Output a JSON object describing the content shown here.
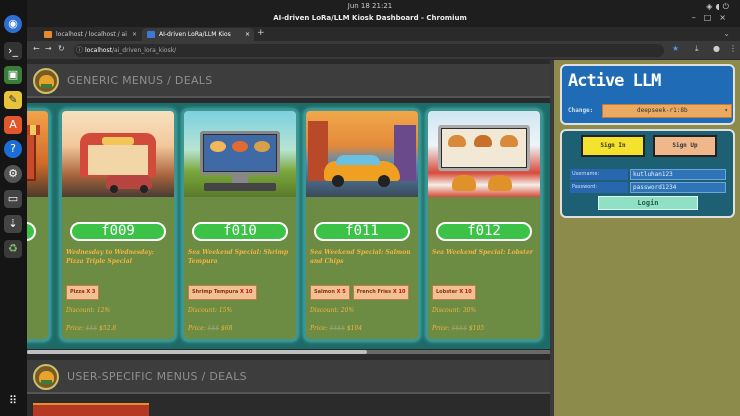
{
  "system": {
    "datetime": "Jun 18  21:21",
    "window_title": "AI-driven LoRa/LLM Kiosk Dashboard - Chromium"
  },
  "browser": {
    "tabs": [
      {
        "label": "localhost / localhost / ai",
        "active": false
      },
      {
        "label": "AI-driven LoRa/LLM Kios",
        "active": true
      }
    ],
    "url_host": "localhost",
    "url_path": "/ai_driven_lora_kiosk/"
  },
  "sections": {
    "generic_title": "GENERIC MENUS / DEALS",
    "user_title": "USER-SPECIFIC MENUS / DEALS"
  },
  "cards": [
    {
      "id": "f009",
      "title": "Wednesday to Wednesday: Pizza Triple Special",
      "items": [
        {
          "name": "Pizza",
          "qty": "X 3"
        }
      ],
      "discount": "Discount:  12%",
      "price_label": "Price: ",
      "old_price": "$$$",
      "new_price": " $52.8"
    },
    {
      "id": "f010",
      "title": "Sea Weekend Special: Shrimp Tempura",
      "items": [
        {
          "name": "Shrimp Tempura",
          "qty": "X 10"
        }
      ],
      "discount": "Discount:  15%",
      "price_label": "Price: ",
      "old_price": "$$$",
      "new_price": " $68"
    },
    {
      "id": "f011",
      "title": "Sea Weekend Special: Salmon and Chips",
      "items": [
        {
          "name": "Salmon",
          "qty": "X 5"
        },
        {
          "name": "French Fries",
          "qty": "X 10"
        }
      ],
      "discount": "Discount:  20%",
      "price_label": "Price: ",
      "old_price": "$$$$",
      "new_price": " $104"
    },
    {
      "id": "f012",
      "title": "Sea Weekend Special: Lobster",
      "items": [
        {
          "name": "Lobster",
          "qty": "X 10"
        }
      ],
      "discount": "Discount:  30%",
      "price_label": "Price: ",
      "old_price": "$$$$",
      "new_price": " $105"
    }
  ],
  "llm": {
    "title": "Active LLM",
    "change_label": "Change:",
    "selected_model": "deepseek-r1:8b"
  },
  "auth": {
    "sign_in": "Sign In",
    "sign_up": "Sign Up",
    "username_label": "Username:",
    "username_value": "kutluhan123",
    "password_label": "Password:",
    "password_value": "password1234",
    "login": "Login"
  },
  "colors": {
    "accent_green": "#3dc248",
    "teal_track": "#1d6b68",
    "card_bg": "#6c8b43",
    "llm_blue": "#1f6bb5",
    "signin_yellow": "#f4e22c"
  }
}
